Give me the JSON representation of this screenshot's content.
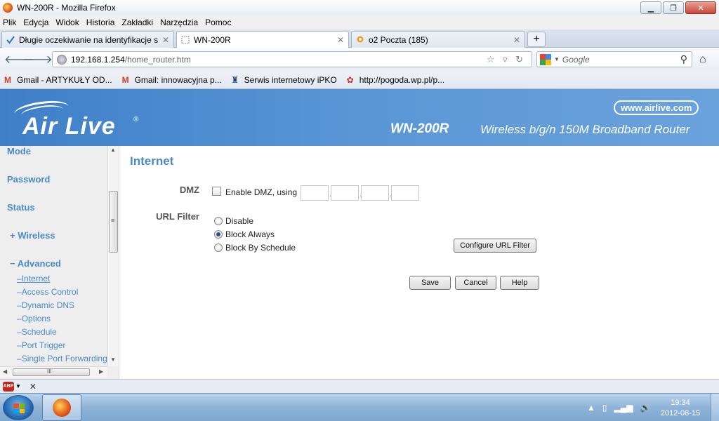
{
  "window": {
    "title": "WN-200R - Mozilla Firefox",
    "minimize_glyph": "▁",
    "maximize_glyph": "❐",
    "close_glyph": "✕"
  },
  "menu": [
    "Plik",
    "Edycja",
    "Widok",
    "Historia",
    "Zakładki",
    "Narzędzia",
    "Pomoc"
  ],
  "tabs": [
    {
      "label": "Długie oczekiwanie na identyfikacje si...",
      "icon": "checkmark-icon",
      "active": false
    },
    {
      "label": "WN-200R",
      "icon": "blank-page-icon",
      "active": true
    },
    {
      "label": "o2 Poczta (185)",
      "icon": "o2-balloon-icon",
      "active": false
    }
  ],
  "tab_close_glyph": "✕",
  "new_tab_glyph": "+",
  "nav": {
    "back_glyph": "🡐",
    "forward_glyph": "🡒",
    "url_host": "192.168.1.254",
    "url_path": "/home_router.htm",
    "url_icons": "☆ ▿ ↻",
    "search_placeholder": "Google",
    "search_glyph": "⚲",
    "home_glyph": "⌂"
  },
  "bookmarks": [
    {
      "label": "Gmail - ARTYKUŁY OD...",
      "icon": "gmail-icon",
      "glyph": "M",
      "color": "#d33b2c"
    },
    {
      "label": "Gmail: innowacyjna p...",
      "icon": "gmail-icon",
      "glyph": "M",
      "color": "#d33b2c"
    },
    {
      "label": "Serwis internetowy iPKO",
      "icon": "pko-icon",
      "glyph": "♜",
      "color": "#1d3d7a"
    },
    {
      "label": "http://pogoda.wp.pl/p...",
      "icon": "wp-icon",
      "glyph": "✿",
      "color": "#d3262c"
    }
  ],
  "banner": {
    "brand": "Air Live",
    "reg": "®",
    "website": "www.airlive.com",
    "model": "WN-200R",
    "description": "Wireless b/g/n 150M Broadband Router"
  },
  "sidebar": {
    "main_items": [
      {
        "label": "Mode"
      },
      {
        "label": "Password"
      },
      {
        "label": "Status"
      },
      {
        "label": "+ Wireless"
      },
      {
        "label": "− Advanced"
      }
    ],
    "sub_items": [
      {
        "label": "Internet",
        "active": true
      },
      {
        "label": "Access Control",
        "active": false
      },
      {
        "label": "Dynamic DNS",
        "active": false
      },
      {
        "label": "Options",
        "active": false
      },
      {
        "label": "Schedule",
        "active": false
      },
      {
        "label": "Port Trigger",
        "active": false
      },
      {
        "label": "Single Port Forwarding",
        "active": false
      }
    ],
    "sub_prefix": "–",
    "scroll_up_glyph": "▲",
    "scroll_down_glyph": "▼",
    "scroll_left_glyph": "◀",
    "scroll_right_glyph": "▶",
    "thumb_grip": "≡",
    "hthumb_grip": "III"
  },
  "main": {
    "title": "Internet",
    "dmz": {
      "label": "DMZ",
      "checkbox_label": "Enable DMZ, using",
      "checked": false,
      "ip_octets": [
        "",
        "",
        "",
        ""
      ],
      "separator": "."
    },
    "url_filter": {
      "label": "URL Filter",
      "options": [
        {
          "label": "Disable",
          "selected": false
        },
        {
          "label": "Block Always",
          "selected": true
        },
        {
          "label": "Block By Schedule",
          "selected": false
        }
      ],
      "configure_button": "Configure URL Filter"
    },
    "buttons": {
      "save": "Save",
      "cancel": "Cancel",
      "help": "Help"
    }
  },
  "addon_bar": {
    "abp_label": "ABP",
    "dropdown_glyph": "▼",
    "close_glyph": "✕"
  },
  "taskbar": {
    "time": "19:34",
    "date": "2012-08-15",
    "tray_icons": [
      "▲",
      "▯",
      "▂▄▆",
      "🔊"
    ]
  }
}
